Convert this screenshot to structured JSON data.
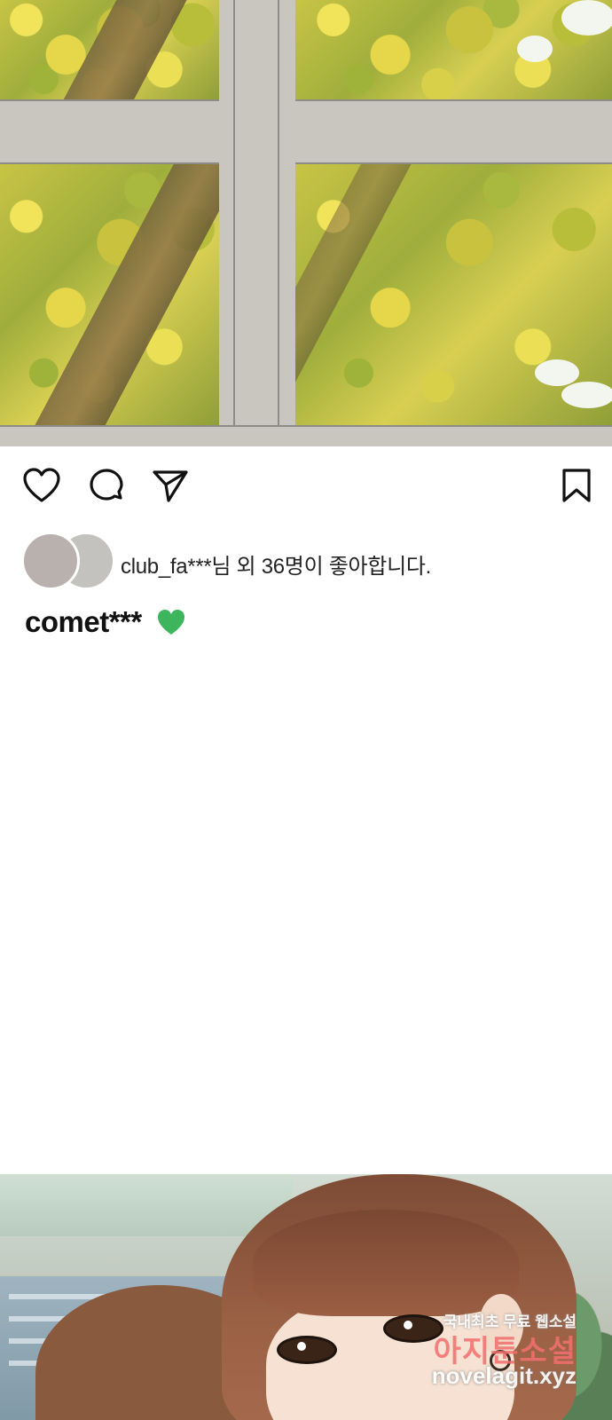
{
  "post": {
    "likes_text": "club_fa***님 외 36명이 좋아합니다.",
    "username": "comet***"
  },
  "icons": {
    "like": "heart-outline-icon",
    "comment": "comment-bubble-icon",
    "share": "paper-plane-icon",
    "save": "bookmark-icon",
    "caption_emoji": "green-heart-icon"
  },
  "colors": {
    "green_heart": "#3cb55c",
    "icon_stroke": "#111111",
    "text": "#222222"
  },
  "watermark": {
    "line1": "국내최초 무료 웹소설",
    "line2": "아지툰소설",
    "line3": "novelagit.xyz"
  }
}
